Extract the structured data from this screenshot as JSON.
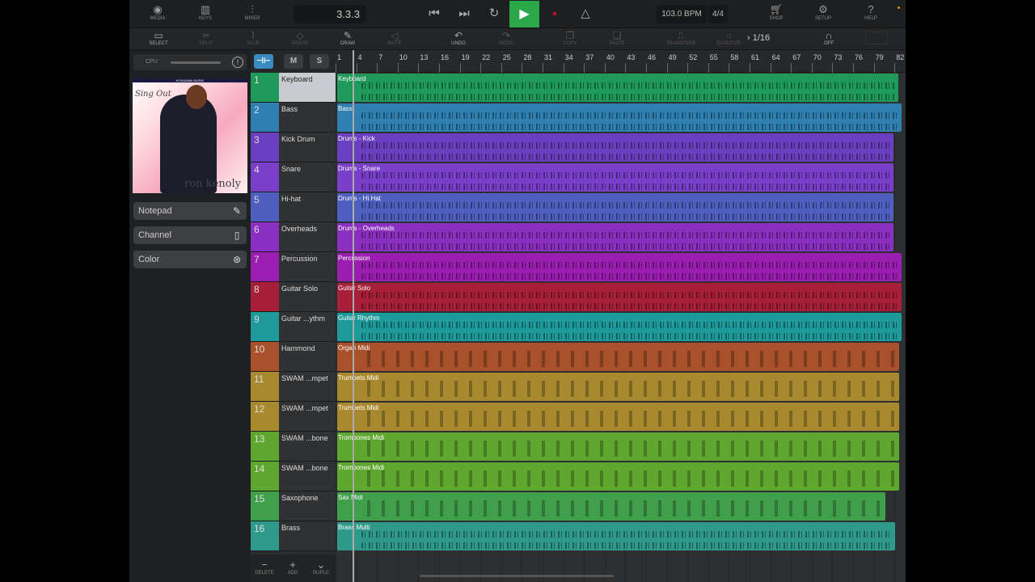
{
  "topbar": {
    "media": "MEDIA",
    "keys": "KEYS",
    "mixer": "MIXER",
    "position": "3.3.3",
    "tempo": "103.0 BPM",
    "signature": "4/4",
    "shop": "SHOP",
    "setup": "SETUP",
    "help": "HELP"
  },
  "toolbar": {
    "select": "SELECT",
    "split": "SPLIT",
    "glue": "GLUE",
    "erase": "ERASE",
    "draw": "DRAW",
    "mute": "MUTE",
    "undo": "UNDO",
    "redo": "REDO",
    "copy": "COPY",
    "paste": "PASTE",
    "transpose": "TRANSPOSE",
    "quantize": "QUANTIZE",
    "grid": "1/16",
    "snap": "OFF"
  },
  "left": {
    "cpu": "CPU",
    "cover_top": "HOSANNA! MUSIC",
    "cover_title": "Sing Out",
    "cover_artist": "ron kenoly",
    "notepad": "Notepad",
    "channel": "Channel",
    "color": "Color"
  },
  "header": {
    "mute": "M",
    "solo": "S"
  },
  "bottom": {
    "delete": "DELETE",
    "add": "ADD",
    "duplicate": "DUPLC"
  },
  "ruler": [
    "1",
    "4",
    "7",
    "10",
    "13",
    "16",
    "19",
    "22",
    "25",
    "28",
    "31",
    "34",
    "37",
    "40",
    "43",
    "46",
    "49",
    "52",
    "55",
    "58",
    "61",
    "64",
    "67",
    "70",
    "73",
    "76",
    "79",
    "82"
  ],
  "tracks": [
    {
      "num": "1",
      "name": "Keyboard",
      "clip": "Keyboard",
      "color": "#1f9a5a",
      "type": "audio"
    },
    {
      "num": "2",
      "name": "Bass",
      "clip": "Bass",
      "color": "#2f7fb0",
      "type": "audio"
    },
    {
      "num": "3",
      "name": "Kick Drum",
      "clip": "Drums - Kick",
      "color": "#6a3fc0",
      "type": "audio"
    },
    {
      "num": "4",
      "name": "Snare",
      "clip": "Drums - Snare",
      "color": "#7a3fc8",
      "type": "audio"
    },
    {
      "num": "5",
      "name": "Hi-hat",
      "clip": "Drums - Hi Hat",
      "color": "#4f5fc0",
      "type": "audio"
    },
    {
      "num": "6",
      "name": "Overheads",
      "clip": "Drums - Overheads",
      "color": "#8a2fc0",
      "type": "audio"
    },
    {
      "num": "7",
      "name": "Percussion",
      "clip": "Percussion",
      "color": "#9a1fb0",
      "type": "audio"
    },
    {
      "num": "8",
      "name": "Guitar Solo",
      "clip": "Guitar Solo",
      "color": "#a81f3a",
      "type": "audio"
    },
    {
      "num": "9",
      "name": "Guitar ...ythm",
      "clip": "Guitar Rhythm",
      "color": "#1f9a9a",
      "type": "audio"
    },
    {
      "num": "10",
      "name": "Hammond",
      "clip": "Organ Midi",
      "color": "#a8512a",
      "type": "midi"
    },
    {
      "num": "11",
      "name": "SWAM ...mpet",
      "clip": "Trumpets Midi",
      "color": "#a8892f",
      "type": "midi"
    },
    {
      "num": "12",
      "name": "SWAM ...mpet",
      "clip": "Trumpets Midi",
      "color": "#a8892f",
      "type": "midi"
    },
    {
      "num": "13",
      "name": "SWAM ...bone",
      "clip": "Trombones Midi",
      "color": "#5fa82f",
      "type": "midi"
    },
    {
      "num": "14",
      "name": "SWAM ...bone",
      "clip": "Trombones Midi",
      "color": "#5fa82f",
      "type": "midi"
    },
    {
      "num": "15",
      "name": "Saxophone",
      "clip": "Sax Midi",
      "color": "#3f9f4a",
      "type": "midi"
    },
    {
      "num": "16",
      "name": "Brass",
      "clip": "Brass Multi",
      "color": "#2f9a8a",
      "type": "audio"
    }
  ]
}
